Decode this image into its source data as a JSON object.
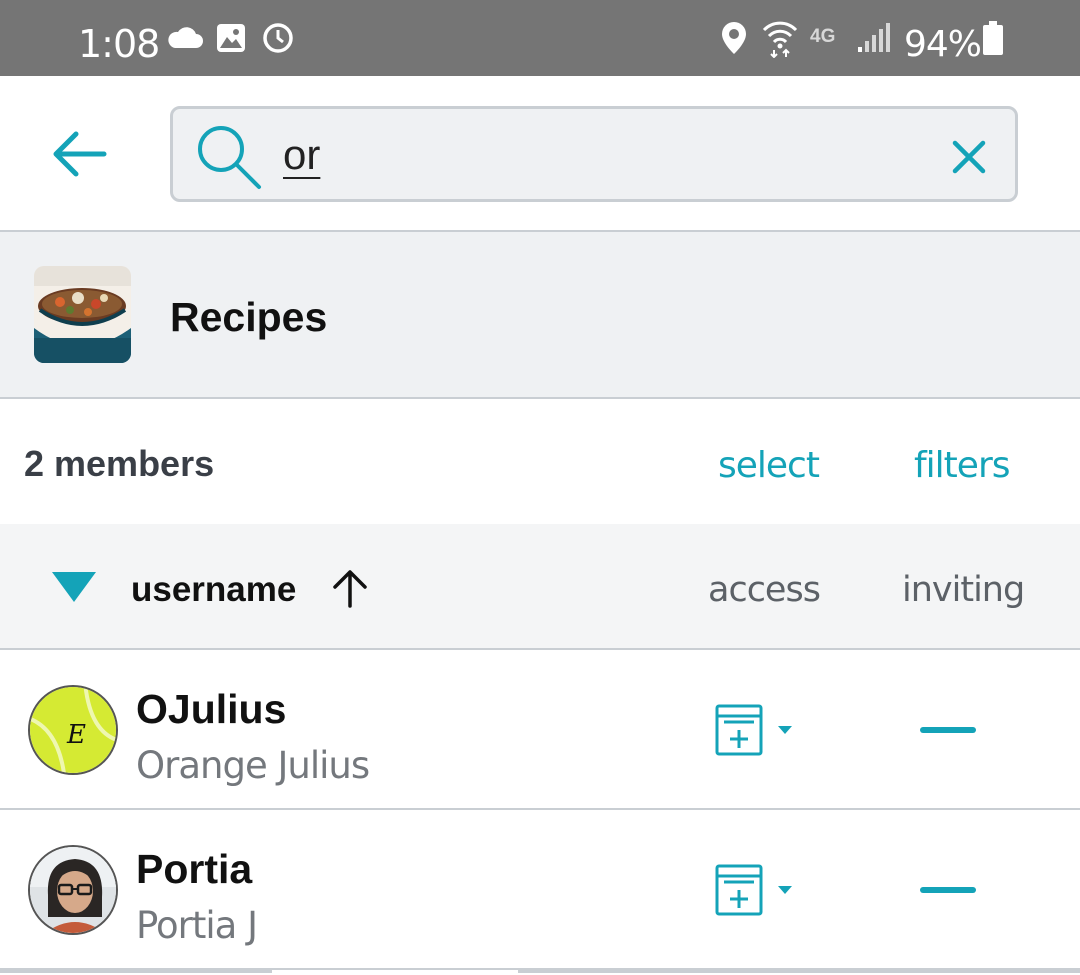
{
  "status_bar": {
    "time": "1:08",
    "network": "4G",
    "battery": "94%",
    "icons": [
      "cloud-icon",
      "image-icon",
      "alarm-icon",
      "location-icon",
      "wifi-icon",
      "signal-icon",
      "battery-icon"
    ]
  },
  "search": {
    "value": "or",
    "placeholder": ""
  },
  "group": {
    "name": "Recipes",
    "thumbnail_icon": "recipe-stew-thumbnail"
  },
  "members_bar": {
    "count_label": "2 members",
    "select_label": "select",
    "filters_label": "filters"
  },
  "columns": {
    "username": "username",
    "access": "access",
    "inviting": "inviting",
    "sort_direction": "ascending"
  },
  "members": [
    {
      "username": "OJulius",
      "full_name": "Orange Julius",
      "avatar": "tennis-ball-avatar",
      "avatar_letter": "E",
      "access_icon": "doc-add-icon",
      "inviting": "none"
    },
    {
      "username": "Portia",
      "full_name": "Portia J",
      "avatar": "photo-avatar",
      "access_icon": "doc-add-icon",
      "inviting": "none"
    }
  ],
  "colors": {
    "accent": "#14a3b8",
    "status_bar": "#757575",
    "panel": "#eff1f3",
    "divider": "#c9ced3"
  }
}
